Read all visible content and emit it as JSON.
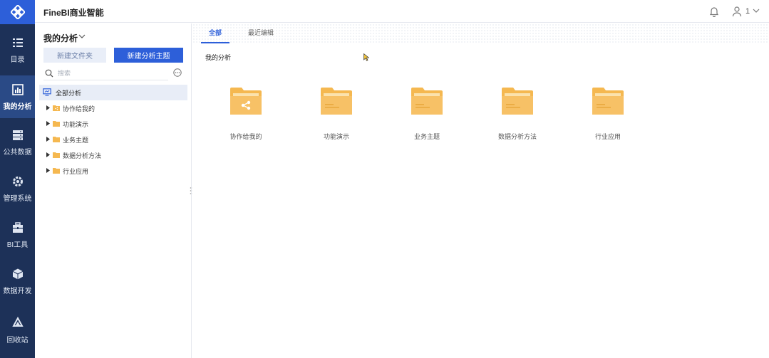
{
  "app": {
    "title": "FineBI商业智能"
  },
  "header": {
    "user_name": "1"
  },
  "rail": {
    "items": [
      {
        "id": "catalog",
        "label": "目录",
        "icon": "list-icon"
      },
      {
        "id": "my-analysis",
        "label": "我的分析",
        "icon": "chart-icon",
        "active": true
      },
      {
        "id": "public-data",
        "label": "公共数据",
        "icon": "database-icon"
      },
      {
        "id": "admin",
        "label": "管理系统",
        "icon": "gear-icon"
      },
      {
        "id": "bi-tools",
        "label": "BI工具",
        "icon": "toolbox-icon"
      },
      {
        "id": "data-dev",
        "label": "数据开发",
        "icon": "cube-icon"
      },
      {
        "id": "recycle",
        "label": "回收站",
        "icon": "recycle-icon"
      }
    ]
  },
  "tree": {
    "title": "我的分析",
    "new_folder_label": "新建文件夹",
    "new_subject_label": "新建分析主题",
    "search_placeholder": "搜索",
    "root_label": "全部分析",
    "nodes": [
      {
        "label": "协作给我的",
        "shared": true
      },
      {
        "label": "功能演示"
      },
      {
        "label": "业务主题"
      },
      {
        "label": "数据分析方法"
      },
      {
        "label": "行业应用"
      }
    ]
  },
  "main": {
    "tabs": [
      {
        "label": "全部",
        "active": true
      },
      {
        "label": "最近编辑"
      }
    ],
    "section_title": "我的分析",
    "cards": [
      {
        "label": "协作给我的",
        "shared": true
      },
      {
        "label": "功能演示"
      },
      {
        "label": "业务主题"
      },
      {
        "label": "数据分析方法"
      },
      {
        "label": "行业应用"
      }
    ]
  },
  "colors": {
    "rail_bg": "#1d3158",
    "accent": "#2d5fd9",
    "folder": "#f5b850"
  }
}
